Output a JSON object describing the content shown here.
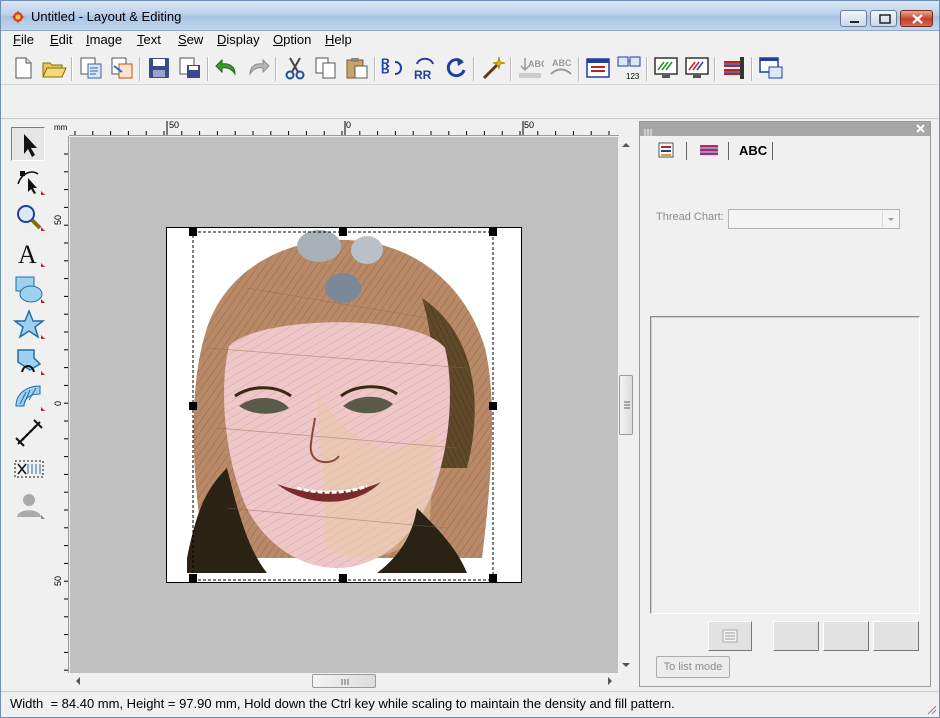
{
  "window": {
    "title": "Untitled - Layout & Editing"
  },
  "menu": [
    "File",
    "Edit",
    "Image",
    "Text",
    "Sew",
    "Display",
    "Option",
    "Help"
  ],
  "toolbar": {
    "buttons": [
      "new-icon",
      "open-icon",
      "import-icon",
      "import-pattern-icon",
      "save-icon",
      "save-as-icon",
      "undo-icon",
      "redo-icon",
      "cut-icon",
      "copy-icon",
      "paste-icon",
      "mirror-horizontal-icon",
      "mirror-vertical-icon",
      "rotate-icon",
      "magic-wand-icon",
      "text-arrange-icon",
      "text-arrange-reset-icon",
      "design-page-icon",
      "sewing-order-icon",
      "stitch-simulator-icon",
      "realistic-preview-icon",
      "thread-color-icon",
      "write-to-card-icon"
    ]
  },
  "tools": [
    "select-icon",
    "point-edit-icon",
    "zoom-icon",
    "text-icon",
    "shape-icon",
    "star-shape-icon",
    "outline-icon",
    "stamp-icon",
    "measure-icon",
    "cut-stitch-icon",
    "photo-stitch-icon"
  ],
  "rulers": {
    "unit": "mm",
    "h_labels": [
      "50",
      "0",
      "50"
    ],
    "v_labels": [
      "50",
      "0",
      "50"
    ]
  },
  "panel": {
    "tabs": [
      "sew-order-icon",
      "color-icon",
      "ABC"
    ],
    "thread_chart_label": "Thread Chart:",
    "thread_chart_value": "",
    "list_mode_button": "To list mode"
  },
  "status": {
    "text": "Width  = 84.40 mm, Height = 97.90 mm, Hold down the Ctrl key while scaling to maintain the density and fill pattern."
  },
  "colors": {
    "canvas_bg": "#c0c0c0",
    "panel_title": "#a6a6a6"
  }
}
